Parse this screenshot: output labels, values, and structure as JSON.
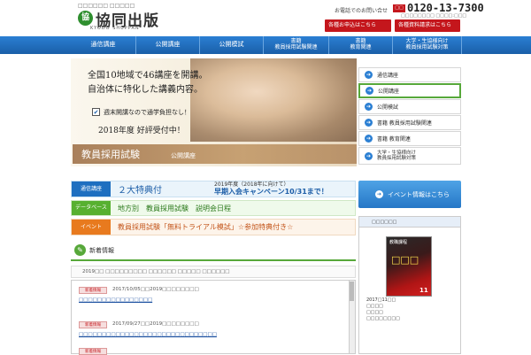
{
  "header": {
    "logo_sub": "□□□□□□ □□□□□",
    "logo_mark": "協",
    "logo_text": "協同出版",
    "logo_en": "KYODO SHUPPAN",
    "contact_label": "お電話でのお問い合せ",
    "phone_badge": "□□",
    "phone_number": "0120-13-7300",
    "phone_hours": "□□□□□□□□ □□□□:□□□",
    "apply_button": "各種お申込はこちら",
    "docs_button": "各種資料請求はこちら"
  },
  "gnav": {
    "items": [
      {
        "line1": "通信講座",
        "line2": ""
      },
      {
        "line1": "公開講座",
        "line2": ""
      },
      {
        "line1": "公開模試",
        "line2": ""
      },
      {
        "line1": "書籍",
        "line2": "教員採用試験関連"
      },
      {
        "line1": "書籍",
        "line2": "教育関連"
      },
      {
        "line1": "大学・生協様向け",
        "line2": "教員採用試験対策"
      }
    ]
  },
  "hero": {
    "line1": "全国10地域で46講座を開講。",
    "line2": "自治体に特化した講義内容。",
    "check": "✔",
    "line3": "週末開講なので通学負担なし！",
    "line4": "2018年度 好評受付中！",
    "band_main": "教員採用試験",
    "band_sub": "公開講座"
  },
  "sidenav": {
    "items": [
      {
        "label": "通信講座",
        "label2": ""
      },
      {
        "label": "公開講座",
        "label2": ""
      },
      {
        "label": "公開模試",
        "label2": ""
      },
      {
        "label": "書籍 教員採用試験関連",
        "label2": ""
      },
      {
        "label": "書籍 教育関連",
        "label2": ""
      },
      {
        "label": "大学・生協様向け",
        "label2": "教員採用試験対策"
      }
    ],
    "arrow": "➔"
  },
  "promos": {
    "row1_tag": "通信講座",
    "row1_text": "２大特典付",
    "row1_sub": "2019年度（2018年に向けて）",
    "row1_campaign": "早期入会キャンペーン10/31まで！",
    "row2_tag": "データベース",
    "row2_text": "地方別　教員採用試験　説明会日程",
    "row3_tag": "イベント",
    "row3_text": "教員採用試験「無料トライアル模試」☆参加特典付き☆"
  },
  "news": {
    "icon": "✎",
    "title": "新着情報",
    "note": "2019□□ □□□□□□□□□ □□□□□□ □□□□□ □□□□□□",
    "items": [
      {
        "badge": "新着情報",
        "date": "2017/10/05□□2019□□□□□□□□",
        "link": "□□□□□□□□□□□□□□□□"
      },
      {
        "badge": "新着情報",
        "date": "2017/09/27□□2019□□□□□□□□",
        "link": "□□□□□□□□□□□□□□□□□□□□□□□□□□□□□□"
      },
      {
        "badge": "新着情報",
        "date": "",
        "link": ""
      }
    ]
  },
  "event_button": "イベント情報はこちら",
  "info": {
    "head": "□□□□□□",
    "book_top": "教職課程",
    "book_big": "□□□",
    "book_num": "11",
    "cap1": "2017□11□□",
    "cap2": "□□□□",
    "cap3": "□□□□",
    "cap4": "□□□□□□□□"
  }
}
